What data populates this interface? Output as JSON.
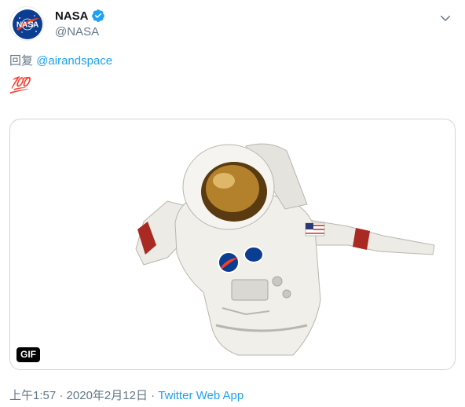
{
  "account": {
    "name": "NASA",
    "handle": "@NASA",
    "avatar_label": "NASA",
    "verified": true
  },
  "tweet": {
    "reply_prefix": "回复",
    "reply_mention": "@airandspace",
    "emoji": "💯",
    "media": {
      "badge": "GIF"
    }
  },
  "footer": {
    "time": "上午1:57",
    "separator": "·",
    "date": "2020年2月12日",
    "source": "Twitter Web App"
  },
  "colors": {
    "accent": "#1da1f2",
    "muted": "#657786",
    "border": "#ccd6dd"
  },
  "icons": {
    "verified": "verified-badge-icon",
    "menu": "chevron-down-icon"
  }
}
